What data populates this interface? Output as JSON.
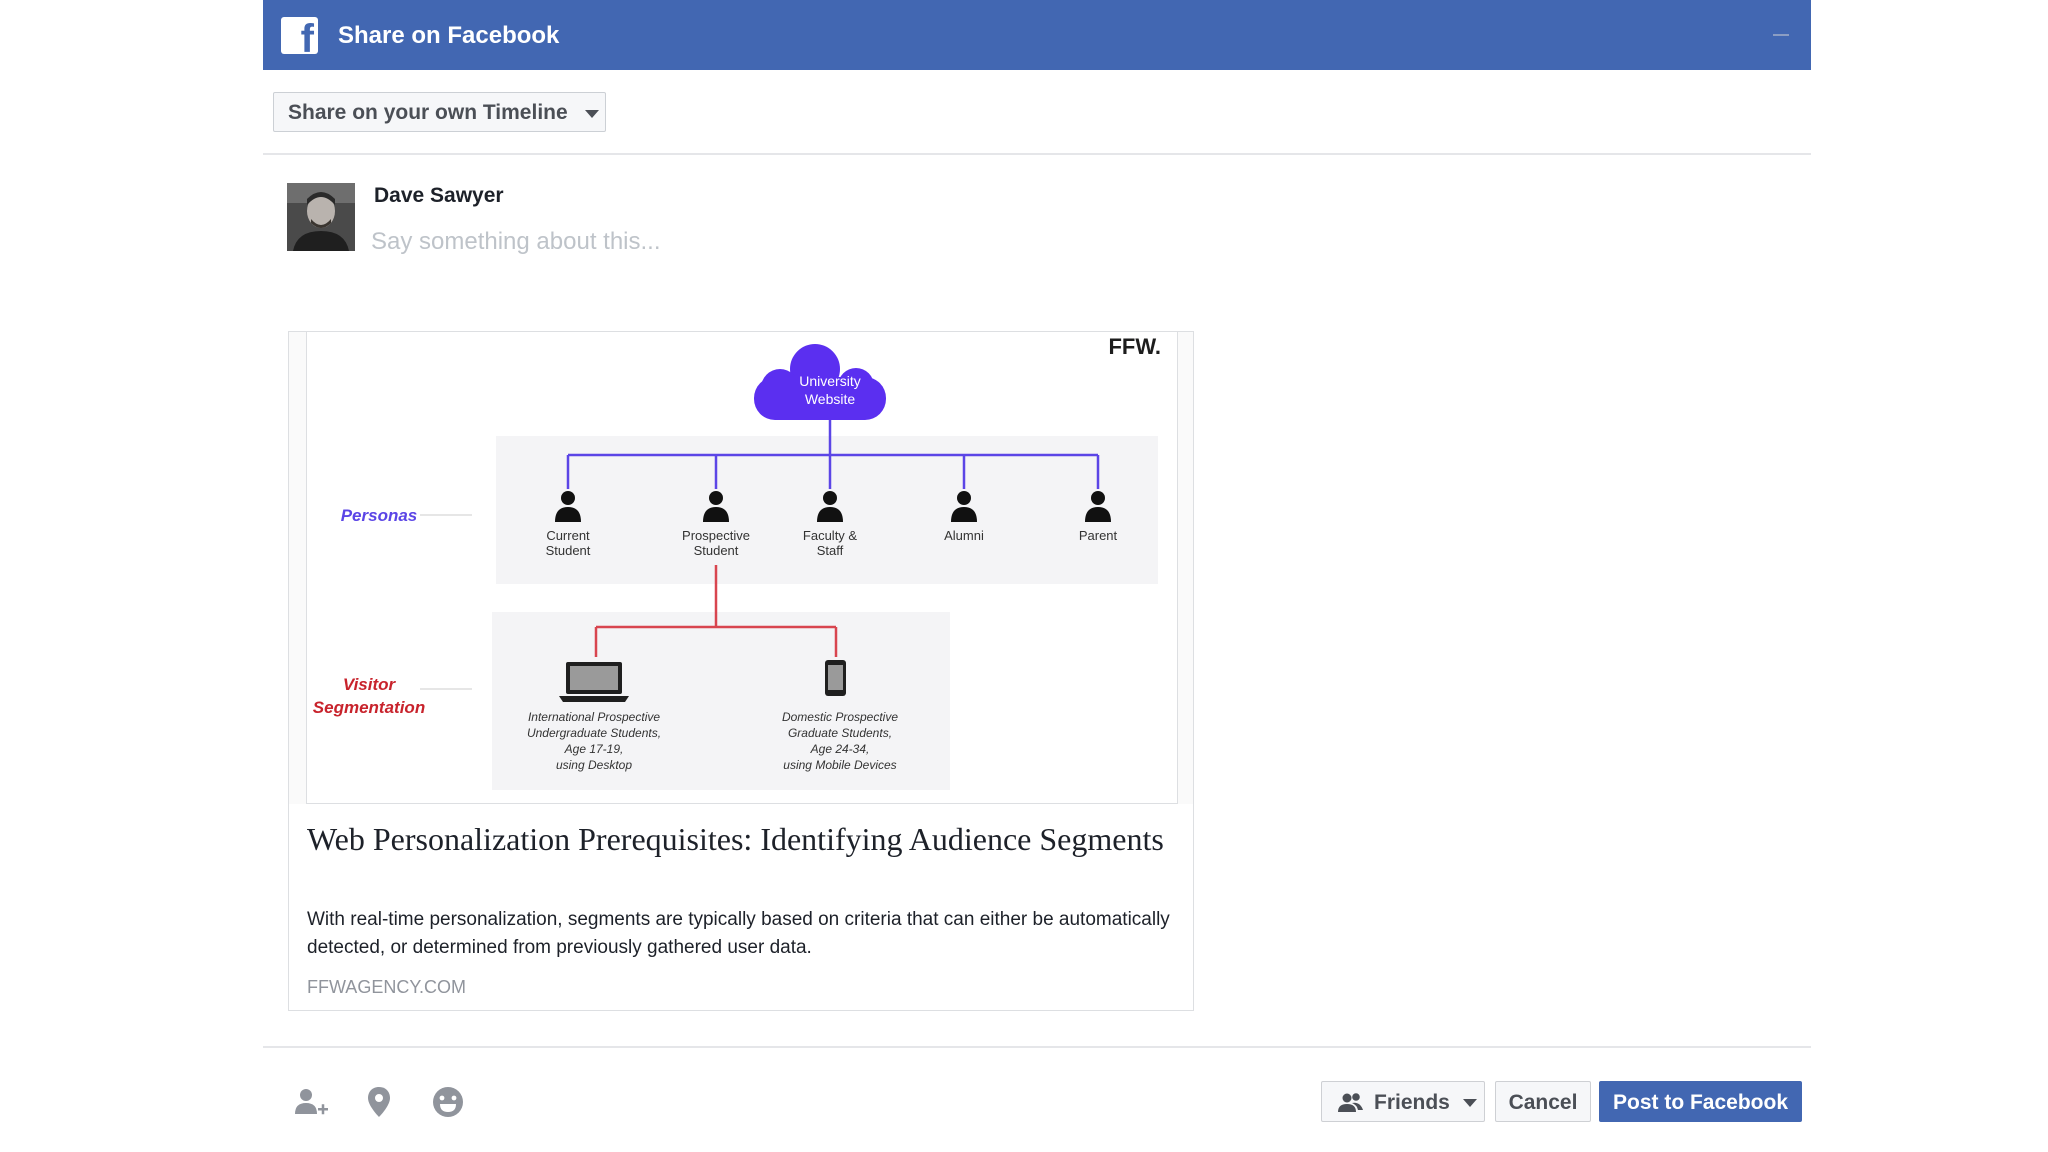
{
  "header": {
    "title": "Share on Facebook",
    "logo_letter": "f"
  },
  "audience_selector": {
    "label": "Share on your own Timeline"
  },
  "composer": {
    "user_name": "Dave Sawyer",
    "placeholder": "Say something about this..."
  },
  "link_preview": {
    "title": "Web Personalization Prerequisites: Identifying Audience Segments",
    "description": "With real-time personalization, segments are typically based on criteria that can either be automatically detected, or determined from previously gathered user data.",
    "domain": "FFWAGENCY.COM",
    "image": {
      "brand": "FFW.",
      "cloud_line1": "University",
      "cloud_line2": "Website",
      "personas_label": "Personas",
      "segmentation_line1": "Visitor",
      "segmentation_line2": "Segmentation",
      "personas": [
        {
          "line1": "Current",
          "line2": "Student"
        },
        {
          "line1": "Prospective",
          "line2": "Student"
        },
        {
          "line1": "Faculty &",
          "line2": "Staff"
        },
        {
          "line1": "Alumni",
          "line2": ""
        },
        {
          "line1": "Parent",
          "line2": ""
        }
      ],
      "segments": [
        {
          "lines": [
            "International Prospective",
            "Undergraduate Students,",
            "Age 17-19,",
            "using Desktop"
          ]
        },
        {
          "lines": [
            "Domestic Prospective",
            "Graduate Students,",
            "Age 24-34,",
            "using Mobile Devices"
          ]
        }
      ],
      "colors": {
        "cloud": "#5b2ff0",
        "persona_line": "#5b45e6",
        "segment_line": "#d8454f",
        "personas_text": "#5b45e6",
        "segmentation_text": "#c8232c"
      }
    }
  },
  "footer": {
    "icons": [
      "tag-friends-icon",
      "location-pin-icon",
      "feeling-emoji-icon"
    ],
    "privacy_label": "Friends",
    "cancel_label": "Cancel",
    "post_label": "Post to Facebook"
  },
  "colors": {
    "brand": "#4267b2",
    "divider": "#e5e6e9",
    "muted_text": "#90949c"
  }
}
